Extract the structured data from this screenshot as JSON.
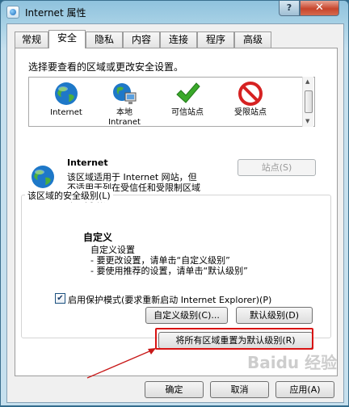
{
  "window": {
    "title": "Internet 属性",
    "help": "?",
    "close": "✕"
  },
  "tabs": [
    {
      "label": "常规"
    },
    {
      "label": "安全",
      "active": true
    },
    {
      "label": "隐私"
    },
    {
      "label": "内容"
    },
    {
      "label": "连接"
    },
    {
      "label": "程序"
    },
    {
      "label": "高级"
    }
  ],
  "security": {
    "prompt": "选择要查看的区域或更改安全设置。",
    "zones": [
      {
        "line1": "Internet",
        "line2": "",
        "icon": "globe-icon"
      },
      {
        "line1": "本地",
        "line2": "Intranet",
        "icon": "local-intranet-icon"
      },
      {
        "line1": "可信站点",
        "line2": "",
        "icon": "check-icon"
      },
      {
        "line1": "受限站点",
        "line2": "",
        "icon": "forbidden-icon"
      }
    ],
    "selected_zone": {
      "name": "Internet",
      "desc_line1": "该区域适用于 Internet 网站，但",
      "desc_line2": "不适用于列在受信任和受限制区域",
      "desc_line3": "中的网站。"
    },
    "sites_button": "站点(S)",
    "level_group_label": "该区域的安全级别(L)",
    "level_title": "自定义",
    "level_line1": "自定义设置",
    "level_line2": "- 要更改设置，请单击“自定义级别”",
    "level_line3": "- 要使用推荐的设置，请单击“默认级别”",
    "protected_mode_label": "启用保护模式(要求重新启动 Internet Explorer)(P)",
    "protected_mode_checked": true,
    "custom_level_button": "自定义级别(C)...",
    "default_level_button": "默认级别(D)",
    "reset_all_button": "将所有区域重置为默认级别(R)"
  },
  "footer": {
    "ok": "确定",
    "cancel": "取消",
    "apply": "应用(A)"
  },
  "watermark": "Baidu 经验",
  "colors": {
    "highlight": "#d81313",
    "accent_blue": "#1b6bb8",
    "check_green": "#3aa92a",
    "forbidden_red": "#d62222"
  }
}
